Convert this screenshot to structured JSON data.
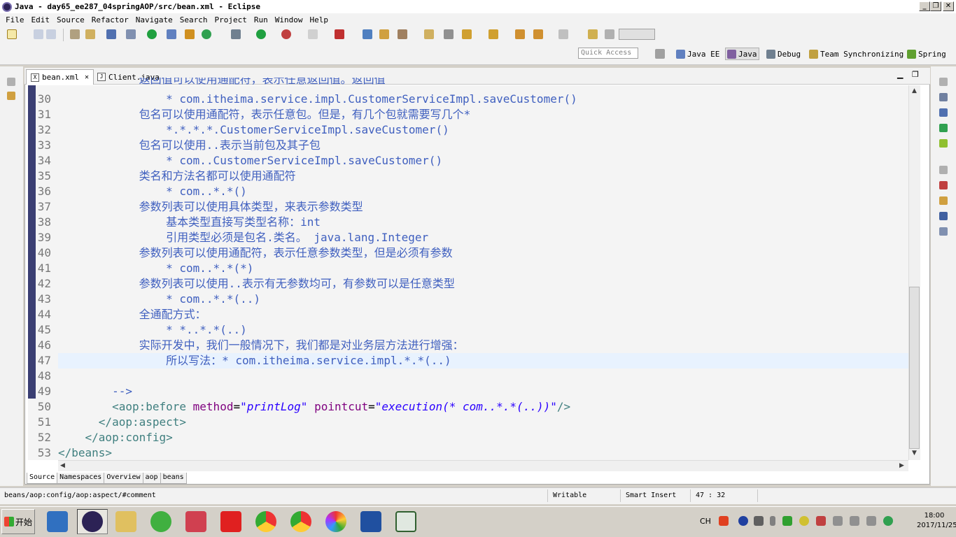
{
  "window": {
    "title": "Java - day65_ee287_04springAOP/src/bean.xml - Eclipse",
    "min": "_",
    "max": "❐",
    "close": "✕"
  },
  "menu": [
    "File",
    "Edit",
    "Source",
    "Refactor",
    "Navigate",
    "Search",
    "Project",
    "Run",
    "Window",
    "Help"
  ],
  "toolbar": {
    "quick_access": "Quick Access"
  },
  "perspectives": [
    "Java EE",
    "Java",
    "Debug",
    "Team Synchronizing",
    "Spring"
  ],
  "tabs": [
    {
      "label": "bean.xml",
      "close": "✕"
    },
    {
      "label": "Client.java"
    }
  ],
  "code": {
    "line_numbers": [
      "30",
      "31",
      "32",
      "33",
      "34",
      "35",
      "36",
      "37",
      "38",
      "39",
      "40",
      "41",
      "42",
      "43",
      "44",
      "45",
      "46",
      "47",
      "48",
      "49",
      "50",
      "51",
      "52",
      "53"
    ],
    "partial_top": "            返回值可以使用通配符，表示任意返回值。返回值",
    "lines": [
      "                * com.itheima.service.impl.CustomerServiceImpl.saveCustomer()",
      "            包名可以使用通配符，表示任意包。但是，有几个包就需要写几个*",
      "                *.*.*.*.CustomerServiceImpl.saveCustomer()",
      "            包名可以使用..表示当前包及其子包",
      "                * com..CustomerServiceImpl.saveCustomer()",
      "            类名和方法名都可以使用通配符",
      "                * com..*.*()",
      "            参数列表可以使用具体类型，来表示参数类型",
      "                基本类型直接写类型名称：int",
      "                引用类型必须是包名.类名。 java.lang.Integer",
      "            参数列表可以使用通配符，表示任意参数类型，但是必须有参数",
      "                * com..*.*(*)",
      "            参数列表可以使用..表示有无参数均可，有参数可以是任意类型",
      "                * com..*.*(..)",
      "            全通配方式：",
      "                * *..*.*(..)",
      "            实际开发中，我们一般情况下，我们都是对业务层方法进行增强：",
      "                所以写法：* com.itheima.service.impl.*.*(..)",
      "",
      "        -->"
    ],
    "line50": {
      "indent": "        ",
      "open": "<aop:before ",
      "attr1": "method",
      "eq": "=",
      "val1": "\"printLog\"",
      "sp": " ",
      "attr2": "pointcut",
      "val2": "\"execution(* com..*.*(..))\"",
      "close": "/>"
    },
    "line51": "      </aop:aspect>",
    "line52": "    </aop:config>",
    "line53": "</beans>"
  },
  "bottom_tabs": [
    "Source",
    "Namespaces",
    "Overview",
    "aop",
    "beans"
  ],
  "status": {
    "path": "beans/aop:config/aop:aspect/#comment",
    "writable": "Writable",
    "insert": "Smart Insert",
    "position": "47 : 32"
  },
  "taskbar": {
    "start": "开始",
    "ime": "CH",
    "time": "18:00",
    "date": "2017/11/25"
  }
}
